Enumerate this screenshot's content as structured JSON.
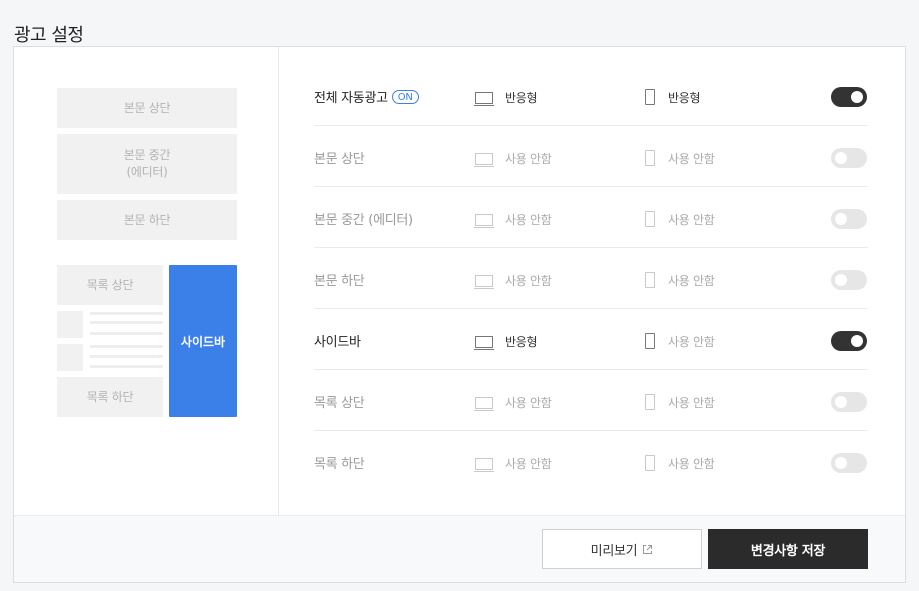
{
  "page": {
    "title": "광고 설정"
  },
  "preview": {
    "body_top": "본문 상단",
    "body_middle_line1": "본문 중간",
    "body_middle_line2": "(에디터)",
    "body_bottom": "본문 하단",
    "list_top": "목록 상단",
    "list_bottom": "목록 하단",
    "sidebar": "사이드바"
  },
  "rows": [
    {
      "label": "전체 자동광고",
      "badge": "ON",
      "pc": "반응형",
      "mobile": "반응형",
      "pc_on": true,
      "mobile_on": true,
      "toggle_on": true
    },
    {
      "label": "본문 상단",
      "pc": "사용 안함",
      "mobile": "사용 안함",
      "pc_on": false,
      "mobile_on": false,
      "toggle_on": false
    },
    {
      "label": "본문 중간 (에디터)",
      "pc": "사용 안함",
      "mobile": "사용 안함",
      "pc_on": false,
      "mobile_on": false,
      "toggle_on": false
    },
    {
      "label": "본문 하단",
      "pc": "사용 안함",
      "mobile": "사용 안함",
      "pc_on": false,
      "mobile_on": false,
      "toggle_on": false
    },
    {
      "label": "사이드바",
      "pc": "반응형",
      "mobile": "사용 안함",
      "pc_on": true,
      "mobile_on": false,
      "toggle_on": true
    },
    {
      "label": "목록 상단",
      "pc": "사용 안함",
      "mobile": "사용 안함",
      "pc_on": false,
      "mobile_on": false,
      "toggle_on": false
    },
    {
      "label": "목록 하단",
      "pc": "사용 안함",
      "mobile": "사용 안함",
      "pc_on": false,
      "mobile_on": false,
      "toggle_on": false
    }
  ],
  "footer": {
    "preview_label": "미리보기",
    "save_label": "변경사항 저장"
  },
  "colors": {
    "accent": "#3b80e8",
    "toggle_on": "#333333",
    "toggle_off": "#e6e6e6",
    "save_button": "#2b2b2b"
  },
  "icons": {
    "pc": "monitor-icon",
    "mobile": "smartphone-icon",
    "preview": "external-link-icon"
  }
}
